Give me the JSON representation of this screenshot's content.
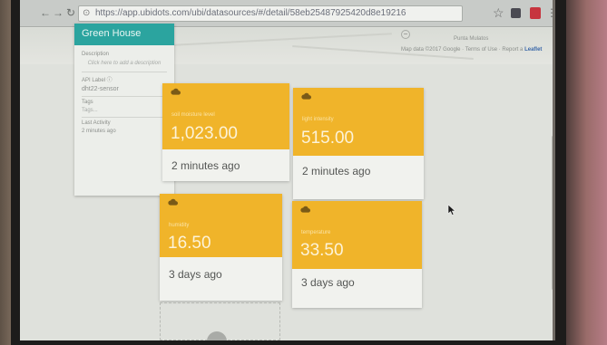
{
  "browser": {
    "url": "https://app.ubidots.com/ubi/datasources/#/detail/58eb25487925420d8e19216",
    "icons": [
      "back-icon",
      "forward-icon",
      "reload-icon",
      "lock-icon",
      "star-icon",
      "menu-icon"
    ]
  },
  "map": {
    "place_label": "Punta Mulatos",
    "attribution": "Map data ©2017 Google · Terms of Use · Report a",
    "leaflet": "Leaflet"
  },
  "device": {
    "name": "Green House",
    "description_label": "Description",
    "description_placeholder": "Click here to add a description",
    "api_label_title": "API Label ⓘ",
    "api_label_value": "dht22-sensor",
    "tags_label": "Tags",
    "tags_placeholder": "Tags...",
    "last_activity_label": "Last Activity",
    "last_activity_value": "2 minutes ago"
  },
  "variables": [
    {
      "name": "soil moisture level",
      "value": "1,023.00",
      "updated": "2 minutes ago"
    },
    {
      "name": "light intensity",
      "value": "515.00",
      "updated": "2 minutes ago"
    },
    {
      "name": "humidity",
      "value": "16.50",
      "updated": "3 days ago"
    },
    {
      "name": "temperature",
      "value": "33.50",
      "updated": "3 days ago"
    }
  ],
  "colors": {
    "accent": "#2ba49f",
    "card": "#f0b42a"
  }
}
